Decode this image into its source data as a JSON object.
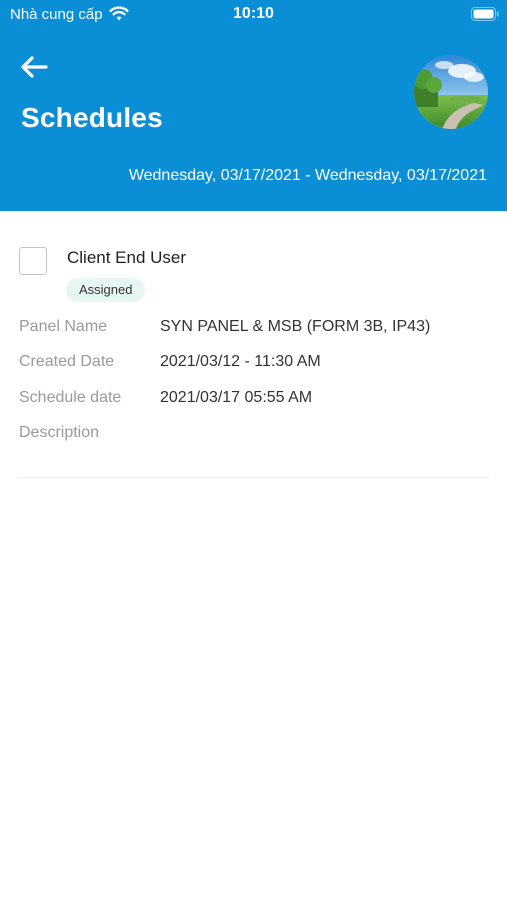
{
  "status_bar": {
    "carrier": "Nhà cung cấp",
    "time": "10:10"
  },
  "header": {
    "title": "Schedules",
    "date_range": "Wednesday, 03/17/2021 - Wednesday, 03/17/2021",
    "background_color": "#0a8fd6"
  },
  "schedule": {
    "client_name": "Client End User",
    "status": "Assigned",
    "status_color": "#e6f7f3",
    "details": [
      {
        "label": "Panel Name",
        "value": "SYN PANEL & MSB (FORM 3B, IP43)"
      },
      {
        "label": "Created Date",
        "value": "2021/03/12 - 11:30 AM"
      },
      {
        "label": "Schedule date",
        "value": "2021/03/17 05:55 AM"
      },
      {
        "label": "Description",
        "value": ""
      }
    ]
  },
  "icons": {
    "back": "arrow-left-icon",
    "wifi": "wifi-icon",
    "battery": "battery-icon",
    "avatar": "landscape-avatar"
  }
}
